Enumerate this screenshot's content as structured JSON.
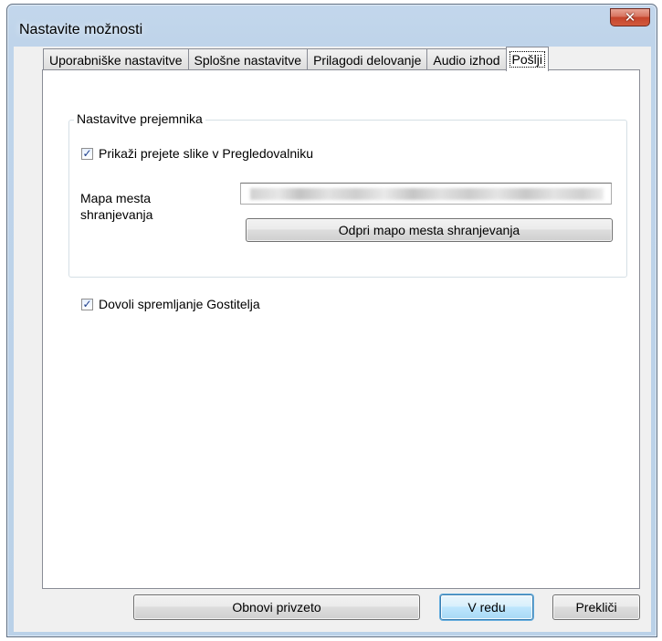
{
  "window": {
    "title": "Nastavite možnosti",
    "close_label": "✕"
  },
  "tabs": [
    {
      "label": "Uporabniške nastavitve",
      "active": false
    },
    {
      "label": "Splošne nastavitve",
      "active": false
    },
    {
      "label": "Prilagodi delovanje",
      "active": false
    },
    {
      "label": "Audio izhod",
      "active": false
    },
    {
      "label": "Pošlji",
      "active": true
    }
  ],
  "receiver_group": {
    "title": "Nastavitve prejemnika",
    "show_images_checkbox": {
      "label": "Prikaži prejete slike v Pregledovalniku",
      "checked": true
    },
    "save_location_label": "Mapa mesta shranjevanja",
    "save_location_value": "",
    "open_folder_button": "Odpri mapo mesta shranjevanja"
  },
  "allow_host_checkbox": {
    "label": "Dovoli spremljanje Gostitelja",
    "checked": true
  },
  "footer": {
    "restore_button": "Obnovi privzeto",
    "ok_button": "V redu",
    "cancel_button": "Prekliči"
  },
  "colors": {
    "title_bar": "#bfd4ea",
    "close_button": "#c5442c",
    "default_button_border": "#3c7fb1"
  },
  "icons": {
    "checkmark": "✓"
  }
}
